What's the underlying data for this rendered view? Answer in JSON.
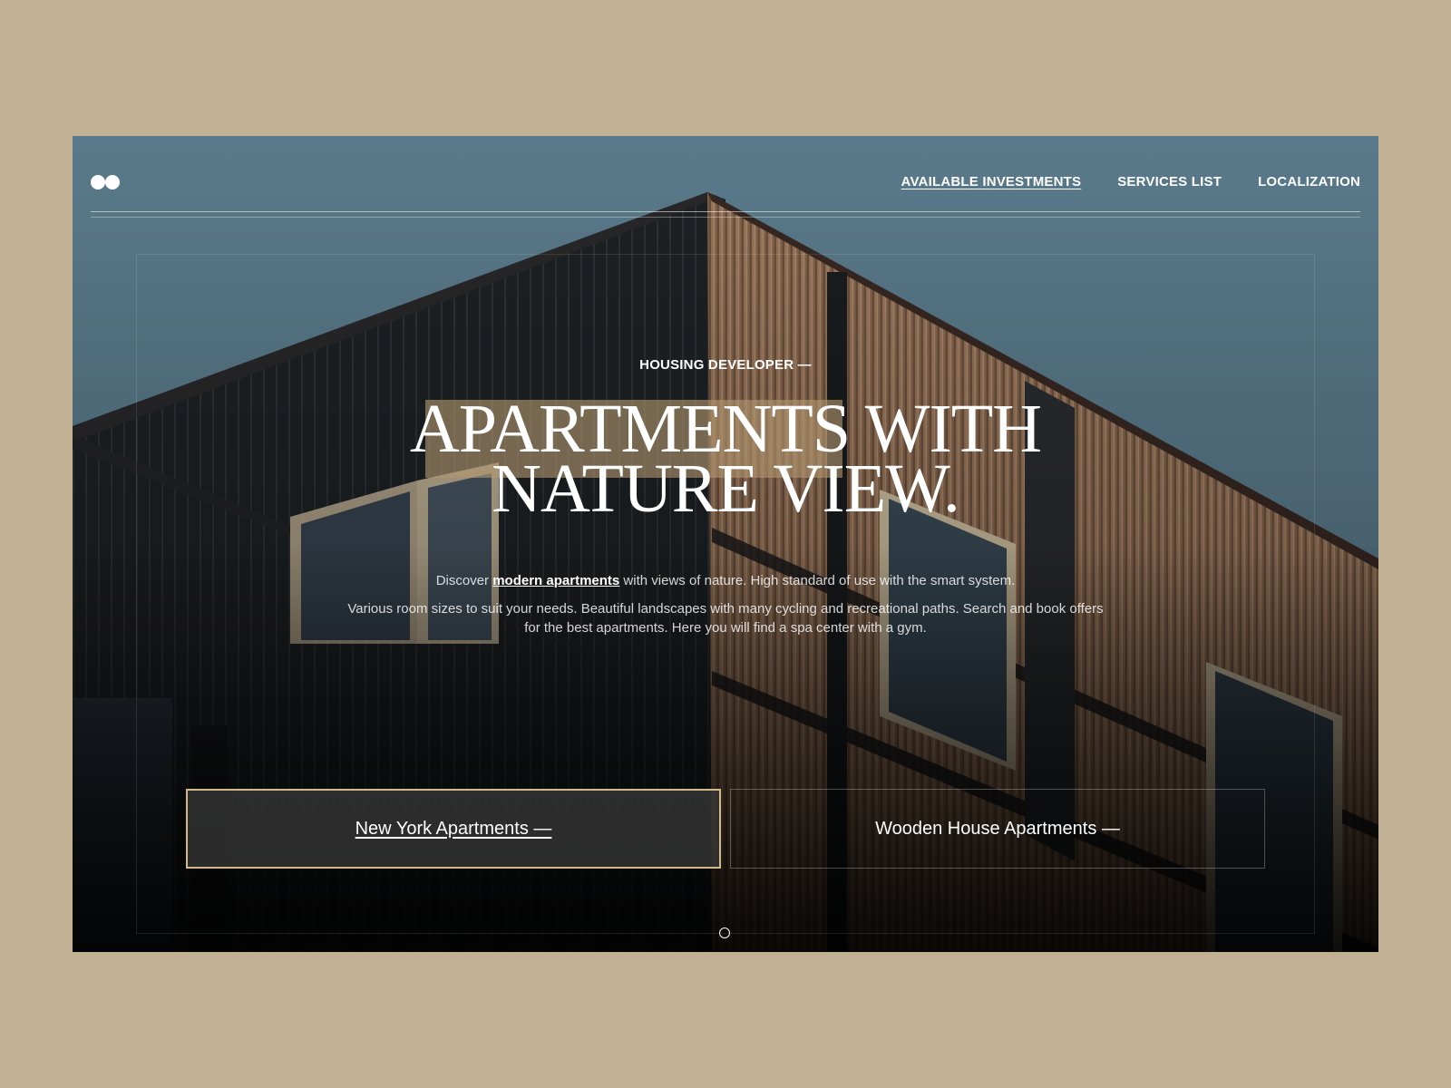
{
  "colors": {
    "page_background": "#c2b094",
    "sky": "#5f8193",
    "accent_gold": "#d3b98c",
    "title_highlight": "#b29670"
  },
  "logo": {
    "icon": "two-circles-logo"
  },
  "nav": {
    "items": [
      {
        "label": "AVAILABLE INVESTMENTS",
        "active": true
      },
      {
        "label": "SERVICES LIST",
        "active": false
      },
      {
        "label": "LOCALIZATION",
        "active": false
      }
    ]
  },
  "hero": {
    "eyebrow": "HOUSING DEVELOPER —",
    "title_line_1": "APARTMENTS WITH",
    "title_line_2": "NATURE VIEW.",
    "desc_1_before": "Discover ",
    "desc_1_link": "modern apartments",
    "desc_1_after": " with views of nature. High standard of use with the smart system.",
    "desc_2": "Various room sizes to suit your needs. Beautiful landscapes with many cycling and recreational paths. Search and book offers for the best apartments. Here you will find a spa center with a gym."
  },
  "cards": {
    "left_label": "New York Apartments —",
    "right_label": "Wooden House Apartments —"
  },
  "slider": {
    "indicator": "circle-indicator"
  }
}
